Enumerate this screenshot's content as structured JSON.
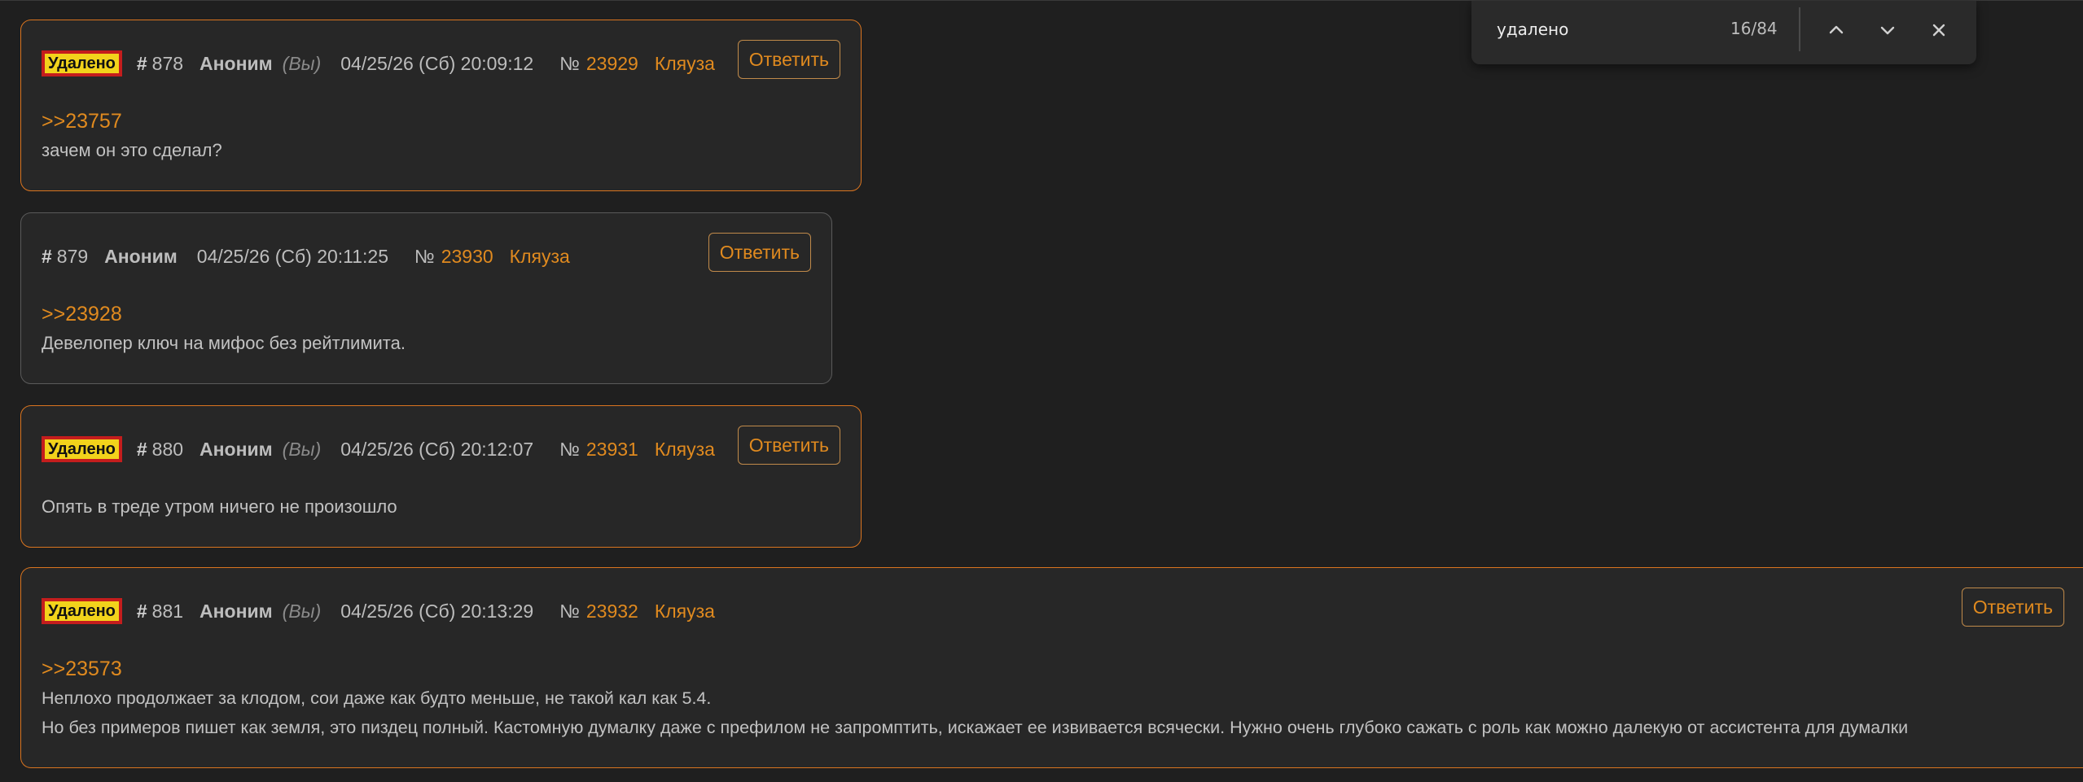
{
  "find_bar": {
    "query": "удалено",
    "count": "16/84"
  },
  "posts": [
    {
      "deleted_label": "Удалено",
      "num_hash": "#",
      "num": "878",
      "author": "Аноним",
      "you": "(Вы)",
      "date": "04/25/26 (Сб) 20:09:12",
      "no_label": "№",
      "no": "23929",
      "complain": "Кляуза",
      "reply": "Ответить",
      "quote": ">>23757",
      "lines": [
        "зачем он это сделал?"
      ]
    },
    {
      "num_hash": "#",
      "num": "879",
      "author": "Аноним",
      "date": "04/25/26 (Сб) 20:11:25",
      "no_label": "№",
      "no": "23930",
      "complain": "Кляуза",
      "reply": "Ответить",
      "quote": ">>23928",
      "lines": [
        "Девелопер ключ на мифос без рейтлимита."
      ]
    },
    {
      "deleted_label": "Удалено",
      "num_hash": "#",
      "num": "880",
      "author": "Аноним",
      "you": "(Вы)",
      "date": "04/25/26 (Сб) 20:12:07",
      "no_label": "№",
      "no": "23931",
      "complain": "Кляуза",
      "reply": "Ответить",
      "lines": [
        "Опять в треде утром ничего не произошло"
      ]
    },
    {
      "deleted_label": "Удалено",
      "num_hash": "#",
      "num": "881",
      "author": "Аноним",
      "you": "(Вы)",
      "date": "04/25/26 (Сб) 20:13:29",
      "no_label": "№",
      "no": "23932",
      "complain": "Кляуза",
      "reply": "Ответить",
      "quote": ">>23573",
      "lines": [
        "Неплохо продолжает за клодом, сои даже как будто меньше, не такой кал как 5.4.",
        "Но без примеров пишет как земля, это пиздец полный. Кастомную думалку даже с префилом не запромптить, искажает ее извивается всячески. Нужно очень глубоко сажать с роль как можно далекую от ассистента для думалки"
      ]
    }
  ],
  "colors": {
    "accent": "#e08a1f",
    "deleted_border": "#d9741f",
    "badge_bg": "#f2d31b",
    "badge_border": "#c41d1d"
  },
  "icons": [
    "arrow-up-icon",
    "arrow-down-icon",
    "close-icon"
  ]
}
